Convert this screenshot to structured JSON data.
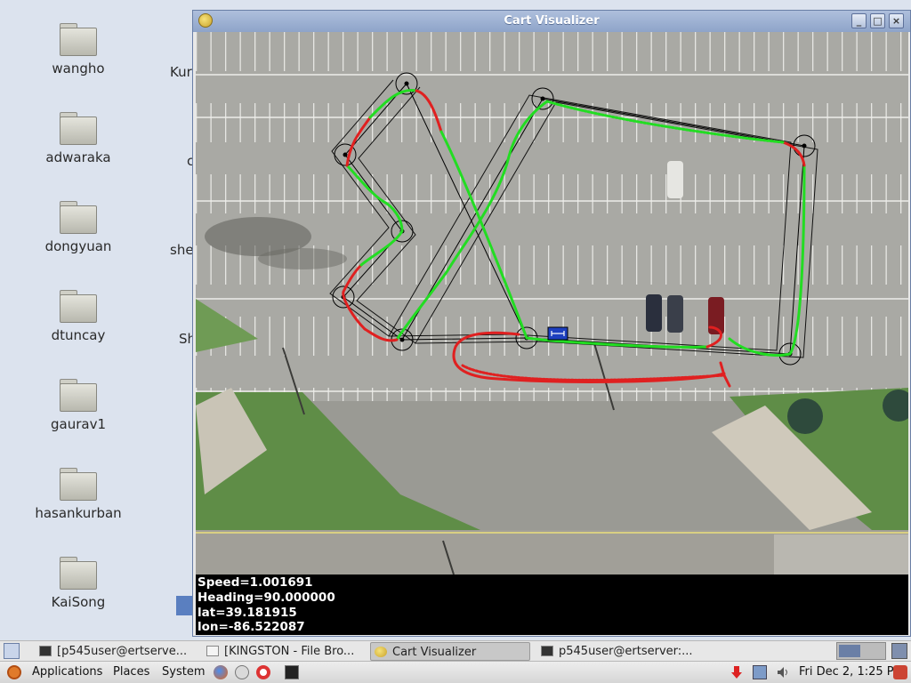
{
  "desktop": {
    "icons": [
      {
        "label": "wangho"
      },
      {
        "label": "adwaraka"
      },
      {
        "label": "dongyuan"
      },
      {
        "label": "dtuncay"
      },
      {
        "label": "gaurav1"
      },
      {
        "label": "hasankurban"
      },
      {
        "label": "KaiSong"
      }
    ],
    "peek_labels": [
      "Kur",
      "c",
      "she",
      "Sh"
    ]
  },
  "window": {
    "title": "Cart Visualizer",
    "readout": {
      "speed": "Speed=1.001691",
      "heading": "Heading=90.000000",
      "lat": "lat=39.181915",
      "lon": "lon=-86.522087"
    }
  },
  "taskbar": {
    "tasks": [
      {
        "label": "[p545user@ertserve...",
        "icon": "terminal-icon"
      },
      {
        "label": "[KINGSTON - File Bro...",
        "icon": "file-browser-icon"
      },
      {
        "label": "Cart Visualizer",
        "icon": "python-icon",
        "active": true
      },
      {
        "label": "p545user@ertserver:...",
        "icon": "terminal-icon"
      }
    ]
  },
  "panel": {
    "menus": [
      "Applications",
      "Places",
      "System"
    ],
    "clock": "Fri Dec  2,  1:25 PM"
  },
  "colors": {
    "track_ok": "#22dd22",
    "track_bad": "#e02020",
    "titlebar": "#9db0d2"
  }
}
